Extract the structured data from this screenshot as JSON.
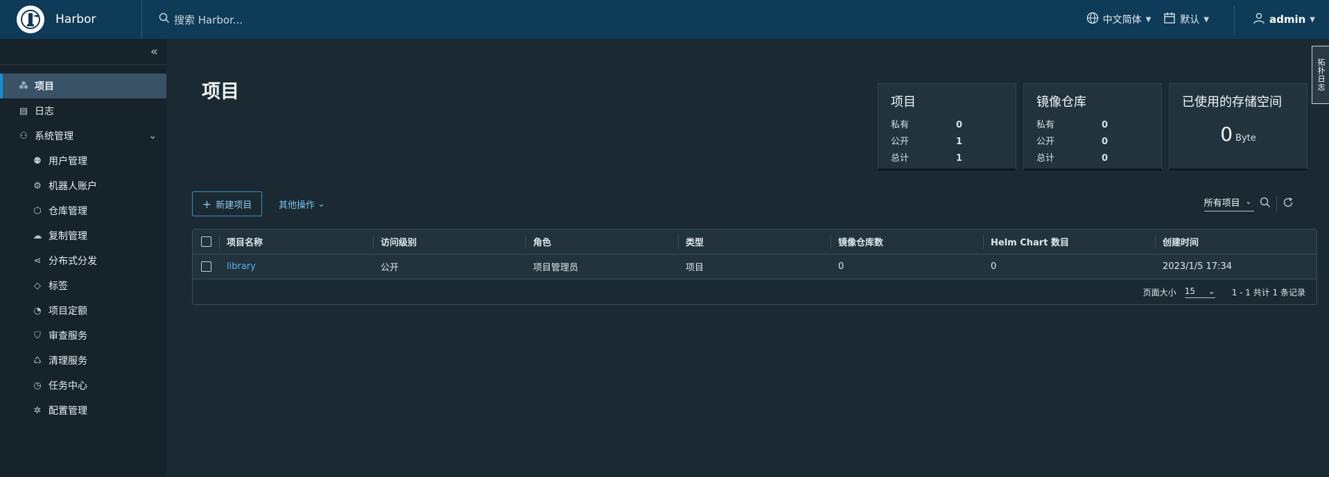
{
  "header": {
    "brand": "Harbor",
    "search_placeholder": "搜索 Harbor...",
    "language": "中文简体",
    "datetime_format": "默认",
    "user": "admin"
  },
  "sidebar": {
    "items": [
      {
        "label": "项目",
        "icon": "projects-icon",
        "active": true
      },
      {
        "label": "日志",
        "icon": "logs-icon"
      },
      {
        "label": "系统管理",
        "icon": "admin-icon",
        "group": true
      }
    ],
    "admin_items": [
      {
        "label": "用户管理",
        "icon": "users-icon"
      },
      {
        "label": "机器人账户",
        "icon": "robot-icon"
      },
      {
        "label": "仓库管理",
        "icon": "registry-icon"
      },
      {
        "label": "复制管理",
        "icon": "replication-icon"
      },
      {
        "label": "分布式分发",
        "icon": "distribution-icon"
      },
      {
        "label": "标签",
        "icon": "tag-icon"
      },
      {
        "label": "项目定额",
        "icon": "quota-icon"
      },
      {
        "label": "审查服务",
        "icon": "shield-icon"
      },
      {
        "label": "清理服务",
        "icon": "trash-icon"
      },
      {
        "label": "任务中心",
        "icon": "dashboard-icon"
      },
      {
        "label": "配置管理",
        "icon": "gear-icon"
      }
    ]
  },
  "main": {
    "title": "项目",
    "cards": {
      "projects": {
        "title": "项目",
        "private_label": "私有",
        "private": "0",
        "public_label": "公开",
        "public": "1",
        "total_label": "总计",
        "total": "1"
      },
      "repos": {
        "title": "镜像仓库",
        "private_label": "私有",
        "private": "0",
        "public_label": "公开",
        "public": "0",
        "total_label": "总计",
        "total": "0"
      },
      "storage": {
        "title": "已使用的存储空间",
        "value": "0",
        "unit": "Byte"
      }
    },
    "new_project": "新建项目",
    "more_actions": "其他操作",
    "filter": "所有项目",
    "columns": [
      "项目名称",
      "访问级别",
      "角色",
      "类型",
      "镜像仓库数",
      "Helm Chart 数目",
      "创建时间"
    ],
    "rows": [
      {
        "name": "library",
        "access": "公开",
        "role": "项目管理员",
        "type": "项目",
        "repos": "0",
        "charts": "0",
        "created": "2023/1/5 17:34"
      }
    ],
    "footer": {
      "page_size_label": "页面大小",
      "page_size": "15",
      "info": "1 - 1 共计 1 条记录"
    }
  },
  "float_tab": "拓扑日志",
  "colors": {
    "header_bg": "#0e3b57",
    "sidebar_bg": "#17232a",
    "main_bg": "#1b2a32",
    "accent": "#1b8ccb",
    "link": "#57b3ee"
  }
}
